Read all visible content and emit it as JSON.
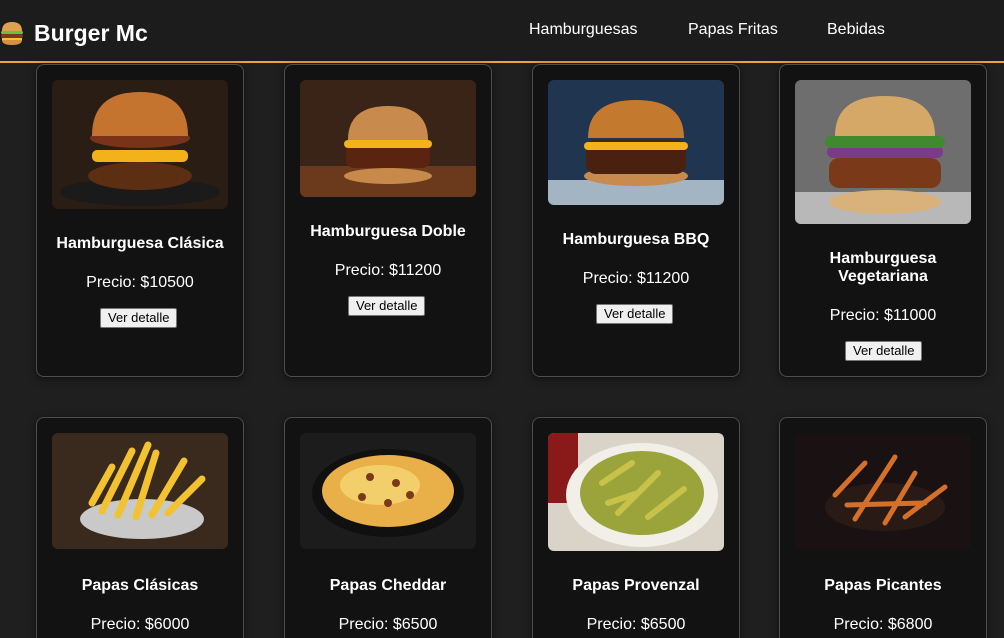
{
  "header": {
    "brand": "Burger Mc",
    "logo_icon": "burger-icon",
    "accent_color": "#e8a63a",
    "nav": [
      "Hamburguesas",
      "Papas Fritas",
      "Bebidas"
    ]
  },
  "products": [
    {
      "name": "Hamburguesa Clásica",
      "price": "Precio: $10500",
      "button": "Ver detalle",
      "image": "classic-burger-photo"
    },
    {
      "name": "Hamburguesa Doble",
      "price": "Precio: $11200",
      "button": "Ver detalle",
      "image": "double-burger-photo"
    },
    {
      "name": "Hamburguesa BBQ",
      "price": "Precio: $11200",
      "button": "Ver detalle",
      "image": "bbq-burger-photo"
    },
    {
      "name": "Hamburguesa Vegetariana",
      "price": "Precio: $11000",
      "button": "Ver detalle",
      "image": "veggie-burger-photo"
    },
    {
      "name": "Papas Clásicas",
      "price": "Precio: $6000",
      "image": "classic-fries-photo"
    },
    {
      "name": "Papas Cheddar",
      "price": "Precio: $6500",
      "image": "cheddar-fries-photo"
    },
    {
      "name": "Papas Provenzal",
      "price": "Precio: $6500",
      "image": "provenzal-fries-photo"
    },
    {
      "name": "Papas Picantes",
      "price": "Precio: $6800",
      "image": "spicy-fries-photo"
    }
  ]
}
